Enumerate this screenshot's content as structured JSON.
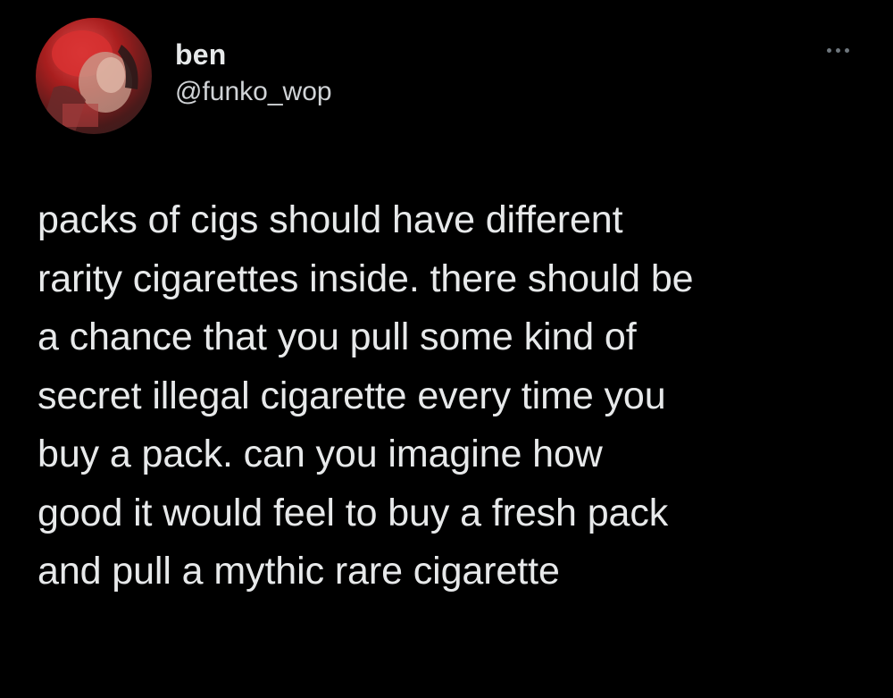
{
  "user": {
    "display_name": "ben",
    "handle": "@funko_wop"
  },
  "menu": {
    "icon": "more-horizontal-icon"
  },
  "tweet": {
    "lines": [
      "packs of cigs should have different",
      "rarity cigarettes inside. there should be",
      "a chance that you pull some kind of",
      "secret illegal cigarette every time you",
      "buy a pack. can you imagine how",
      "good it would feel to buy a fresh pack",
      "and pull a mythic rare cigarette"
    ]
  },
  "colors": {
    "background": "#000000",
    "text": "#e7e9ea",
    "muted": "#6e767d"
  }
}
